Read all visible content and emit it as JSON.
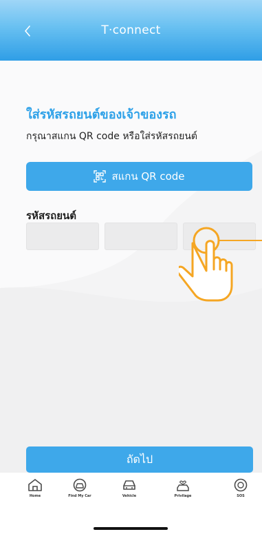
{
  "header": {
    "brand": "T·connect",
    "back_icon": "chevron-left-icon"
  },
  "main": {
    "title": "ใส่รหัสรถยนต์ของเจ้าของรถ",
    "instruction": "กรุณาสแกน QR code หรือใส่รหัสรถยนต์",
    "scan_button_label": "สแกน QR code",
    "scan_icon": "qr-code-icon",
    "code_label": "รหัสรถยนต์",
    "code_fields": [
      "",
      "",
      ""
    ],
    "next_button_label": "ถัดไป"
  },
  "tabbar": {
    "items": [
      {
        "label": "Home",
        "icon": "home-icon"
      },
      {
        "label": "Find My Car",
        "icon": "car-locate-icon"
      },
      {
        "label": "Vehicle",
        "icon": "vehicle-icon"
      },
      {
        "label": "Privilage",
        "icon": "privilege-car-icon"
      },
      {
        "label": "SOS",
        "icon": "sos-icon"
      }
    ]
  },
  "colors": {
    "accent": "#3ea8ea",
    "title": "#2ea1e8",
    "hand_outline": "#f5a623"
  }
}
